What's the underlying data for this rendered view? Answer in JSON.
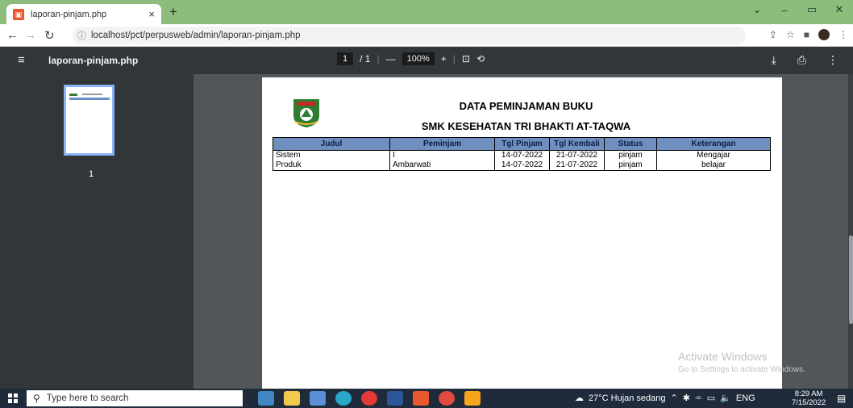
{
  "browser": {
    "tab_title": "laporan-pinjam.php",
    "tab_close": "×",
    "new_tab": "+",
    "url_info": "ⓘ",
    "url": "localhost/pct/perpusweb/admin/laporan-pinjam.php",
    "controls": {
      "minimize": "–",
      "maximize": "▭",
      "close": "✕"
    }
  },
  "pdf_toolbar": {
    "title": "laporan-pinjam.php",
    "page_current": "1",
    "page_total": "/ 1",
    "zoom": "100%",
    "zoom_out": "—",
    "zoom_in": "+"
  },
  "thumbnail": {
    "page_number": "1"
  },
  "document": {
    "title": "DATA PEMINJAMAN BUKU",
    "subtitle": "SMK KESEHATAN TRI BHAKTI AT-TAQWA",
    "columns": [
      "Judul",
      "Peminjam",
      "Tgl Pinjam",
      "Tgl Kembali",
      "Status",
      "Keterangan"
    ],
    "rows": [
      [
        "Sistem",
        "I",
        "14-07-2022",
        "21-07-2022",
        "pinjam",
        "Mengajar"
      ],
      [
        "Produk",
        "Ambarwati",
        "14-07-2022",
        "21-07-2022",
        "pinjam",
        "belajar"
      ]
    ]
  },
  "watermark": {
    "line1": "Activate Windows",
    "line2": "Go to Settings to activate Windows."
  },
  "taskbar": {
    "search_placeholder": "Type here to search",
    "weather": "27°C  Hujan sedang",
    "language": "ENG",
    "time": "8:29 AM",
    "date": "7/15/2022"
  },
  "colors": {
    "tabbar": "#8cbd7c",
    "table_header": "#6f8fc0",
    "pdf_toolbar": "#323639",
    "viewer_bg": "#525659"
  }
}
